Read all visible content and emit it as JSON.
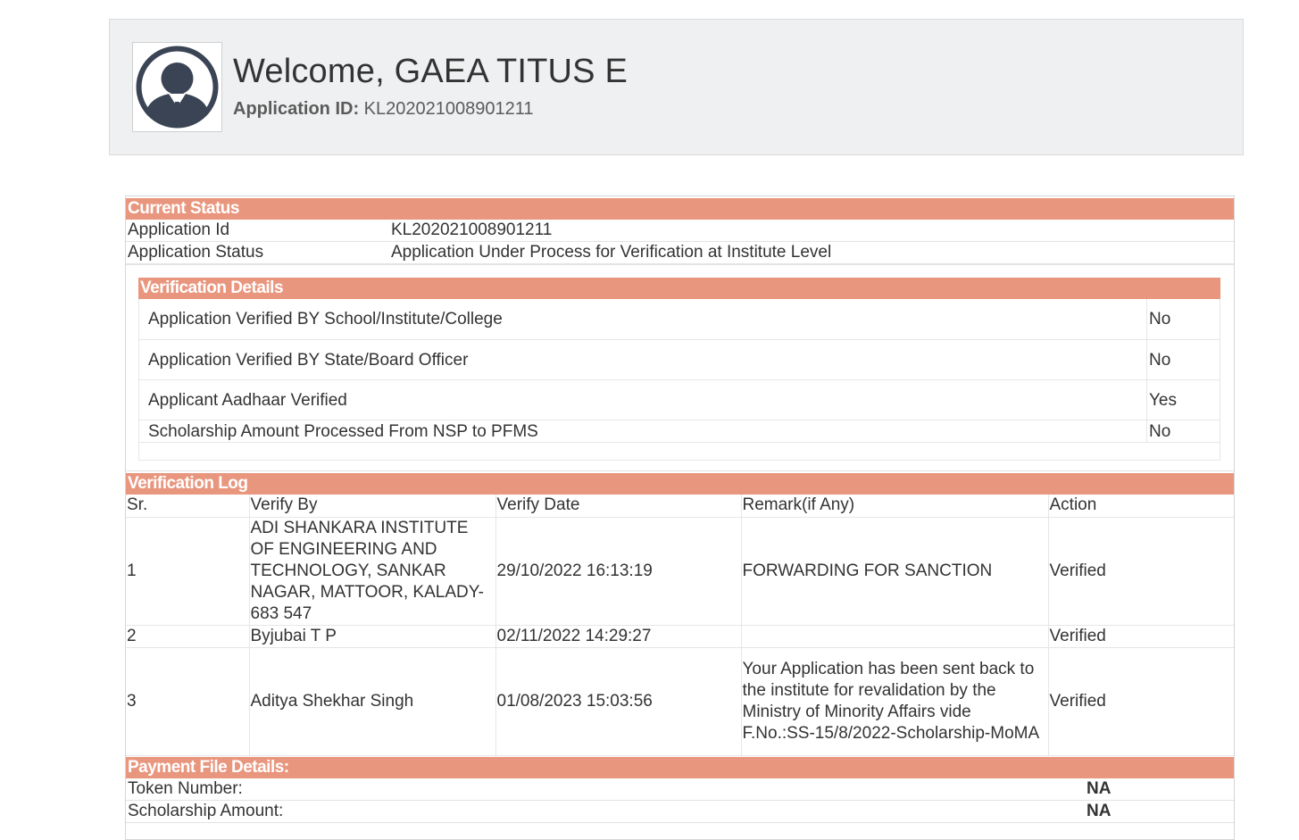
{
  "header": {
    "welcome_text": "Welcome, GAEA TITUS E",
    "app_id_label": "Application ID:",
    "app_id_value": "KL202021008901211"
  },
  "current_status": {
    "title": "Current Status",
    "rows": [
      {
        "label": "Application Id",
        "value": "KL202021008901211"
      },
      {
        "label": "Application Status",
        "value": "Application Under Process for Verification at Institute Level"
      }
    ]
  },
  "verification_details": {
    "title": "Verification Details",
    "rows": [
      {
        "label": "Application Verified BY School/Institute/College",
        "value": "No"
      },
      {
        "label": "Application Verified BY State/Board Officer",
        "value": "No"
      },
      {
        "label": "Applicant Aadhaar Verified",
        "value": "Yes"
      },
      {
        "label": "Scholarship Amount Processed From NSP to PFMS",
        "value": "No"
      }
    ]
  },
  "verification_log": {
    "title": "Verification Log",
    "headers": [
      "Sr.",
      "Verify By",
      "Verify Date",
      "Remark(if Any)",
      "Action"
    ],
    "rows": [
      [
        "1",
        "ADI SHANKARA INSTITUTE OF ENGINEERING AND TECHNOLOGY, SANKAR NAGAR, MATTOOR, KALADY-683 547",
        "29/10/2022 16:13:19",
        "FORWARDING FOR SANCTION",
        "Verified"
      ],
      [
        "2",
        "Byjubai T P",
        "02/11/2022 14:29:27",
        "",
        "Verified"
      ],
      [
        "3",
        "Aditya Shekhar Singh",
        "01/08/2023 15:03:56",
        "Your Application has been sent back to the institute for revalidation by the Ministry of Minority Affairs vide F.No.:SS-15/8/2022-Scholarship-MoMA",
        "Verified"
      ]
    ]
  },
  "payment_file": {
    "title": "Payment File Details:",
    "rows": [
      {
        "label": "Token Number:",
        "value": "NA"
      },
      {
        "label": "Scholarship Amount:",
        "value": "NA"
      }
    ]
  }
}
